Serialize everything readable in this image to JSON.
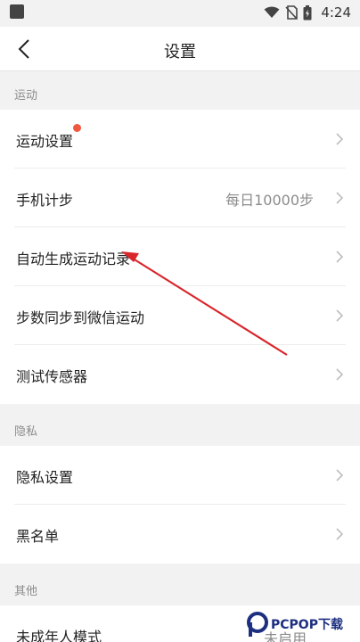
{
  "status_bar": {
    "time": "4:24"
  },
  "nav": {
    "title": "设置"
  },
  "sections": {
    "sport": {
      "header": "运动",
      "items": [
        {
          "label": "运动设置",
          "value": ""
        },
        {
          "label": "手机计步",
          "value": "每日10000步"
        },
        {
          "label": "自动生成运动记录",
          "value": ""
        },
        {
          "label": "步数同步到微信运动",
          "value": ""
        },
        {
          "label": "测试传感器",
          "value": ""
        }
      ]
    },
    "privacy": {
      "header": "隐私",
      "items": [
        {
          "label": "隐私设置",
          "value": ""
        },
        {
          "label": "黑名单",
          "value": ""
        }
      ]
    },
    "other": {
      "header": "其他",
      "items": [
        {
          "label": "未成年人模式",
          "value": "未启用"
        }
      ]
    }
  },
  "colors": {
    "accent_dot": "#f0583f",
    "annotation_arrow": "#d9262b"
  },
  "watermark": {
    "text": "PCPOP下载"
  }
}
